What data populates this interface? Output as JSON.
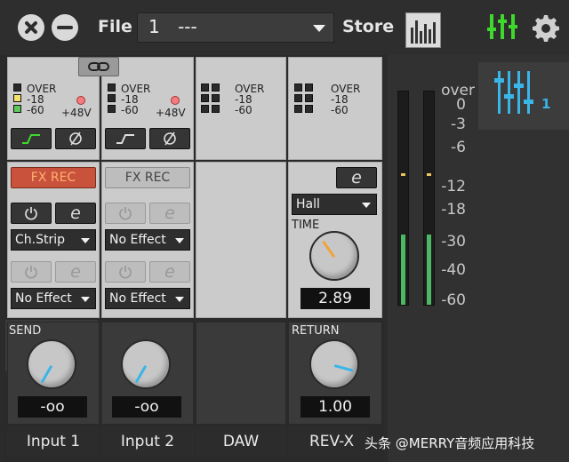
{
  "topbar": {
    "file_label": "File",
    "file_number": "1",
    "file_name": "---",
    "store_label": "Store"
  },
  "channels": [
    {
      "name": "Input 1",
      "meter_labels": [
        "OVER",
        "-18",
        "-60"
      ],
      "phantom_label": "+48V",
      "fx_rec_label": "FX REC",
      "fx_rec_active": true,
      "effect1": "Ch.Strip",
      "effect2": "No Effect",
      "send_label": "SEND",
      "send_value": "-oo"
    },
    {
      "name": "Input 2",
      "meter_labels": [
        "OVER",
        "-18",
        "-60"
      ],
      "phantom_label": "+48V",
      "fx_rec_label": "FX REC",
      "fx_rec_active": false,
      "effect1": "No Effect",
      "effect2": "No Effect",
      "send_value": "-oo"
    },
    {
      "name": "DAW",
      "meter_labels": [
        "OVER",
        "-18",
        "-60"
      ]
    },
    {
      "name": "REV-X",
      "meter_labels": [
        "OVER",
        "-18",
        "-60"
      ],
      "reverb_type": "Hall",
      "time_label": "TIME",
      "time_value": "2.89",
      "return_label": "RETURN",
      "return_value": "1.00"
    }
  ],
  "master_meter": {
    "scale": [
      "over",
      "0",
      "-3",
      "-6",
      "-12",
      "-18",
      "-30",
      "-40",
      "-60"
    ],
    "left_level": 0.33,
    "right_level": 0.33
  },
  "scene_tab": {
    "number": "1"
  },
  "watermark": "头条 @MERRY音频应用科技",
  "colors": {
    "accent_green": "#3fd82c",
    "accent_blue": "#39b5e8",
    "fx_rec_on": "#c8523b",
    "meter_green": "#4cb864"
  }
}
